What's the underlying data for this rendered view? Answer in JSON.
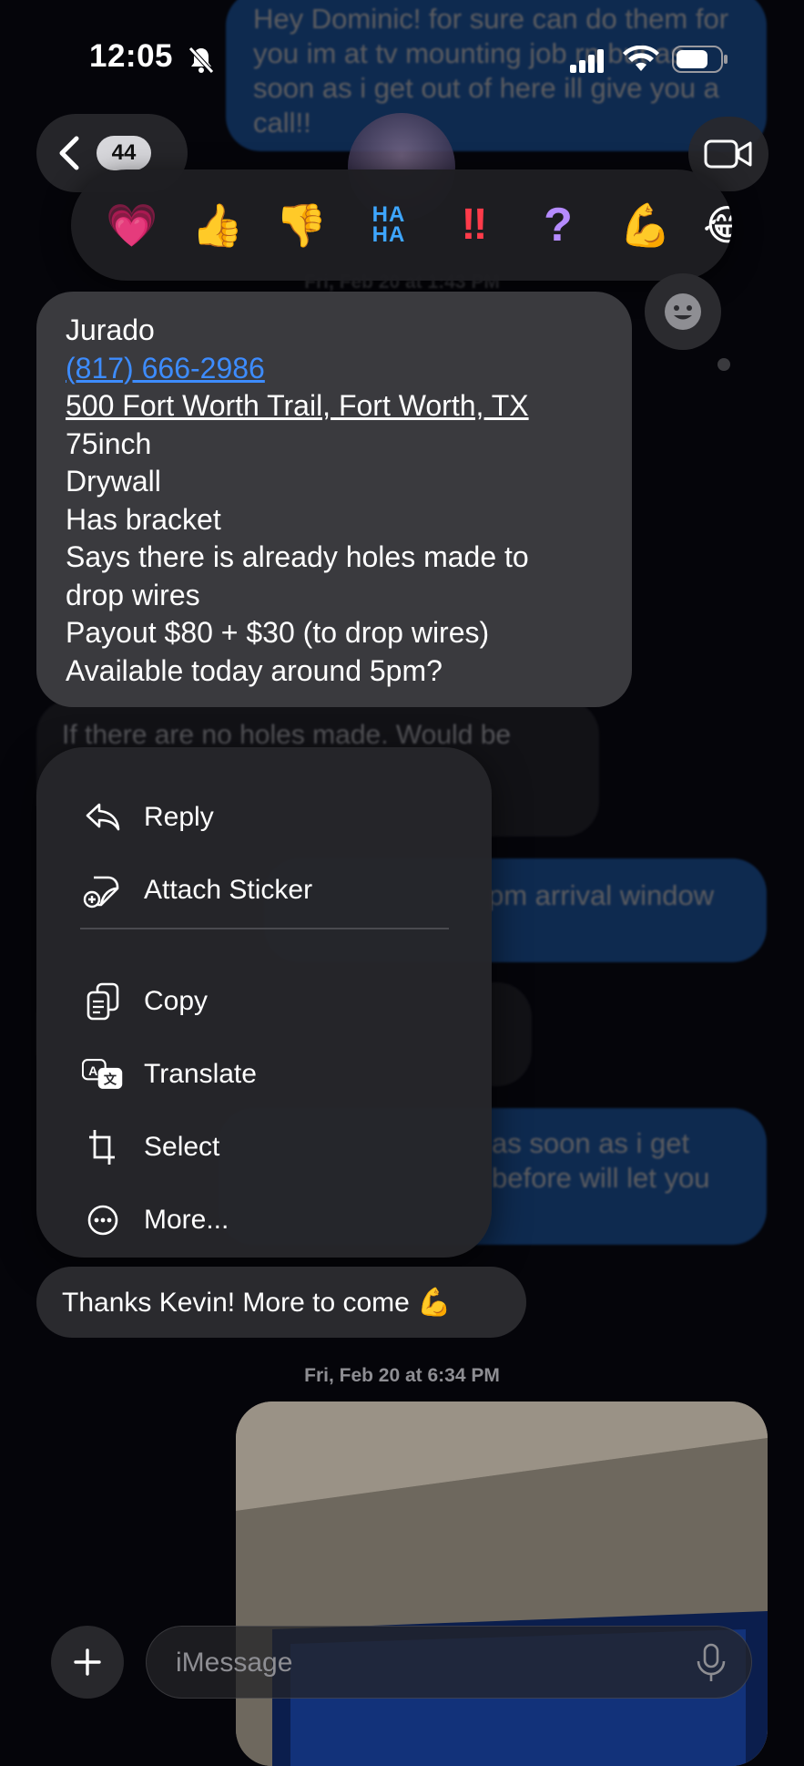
{
  "status_bar": {
    "time": "12:05"
  },
  "nav": {
    "unread_count": "44"
  },
  "background_messages": {
    "top_outgoing": "Hey Dominic! for sure can do them for you im at tv mounting job rn but as soon as i get out of here ill give you a call!!",
    "timestamp_1": "Fri, Feb 20 at 1:43 PM",
    "gray_under": "If there are no holes made. Would be",
    "blue_1": "pm arrival window",
    "blue_2a": "as soon as i get",
    "blue_2b": "before will let you"
  },
  "reactions": [
    {
      "icon": "heart-icon",
      "glyph": "💗"
    },
    {
      "icon": "thumbs-up-icon",
      "glyph": "👍"
    },
    {
      "icon": "thumbs-down-icon",
      "glyph": "👎"
    },
    {
      "icon": "haha-icon",
      "glyph": "HA HA"
    },
    {
      "icon": "exclamation-icon",
      "glyph": "‼"
    },
    {
      "icon": "question-icon",
      "glyph": "?"
    },
    {
      "icon": "flexed-biceps-icon",
      "glyph": "💪"
    },
    {
      "icon": "laughing-face-icon",
      "glyph": "😂"
    }
  ],
  "selected_message": {
    "lines": [
      "Jurado",
      "(817) 666-2986",
      "500 Fort Worth Trail, Fort Worth, TX",
      "75inch",
      "Drywall",
      "Has bracket",
      "Says there is already holes made to",
      "drop wires",
      "Payout $80 + $30 (to drop wires)",
      "Available today around 5pm?"
    ]
  },
  "context_menu": {
    "reply": "Reply",
    "attach_sticker": "Attach Sticker",
    "copy": "Copy",
    "translate": "Translate",
    "select": "Select",
    "more": "More..."
  },
  "thanks_message": "Thanks Kevin! More to come 💪",
  "timestamp_2": "Fri, Feb 20 at 6:34 PM",
  "composer": {
    "placeholder": "iMessage"
  }
}
